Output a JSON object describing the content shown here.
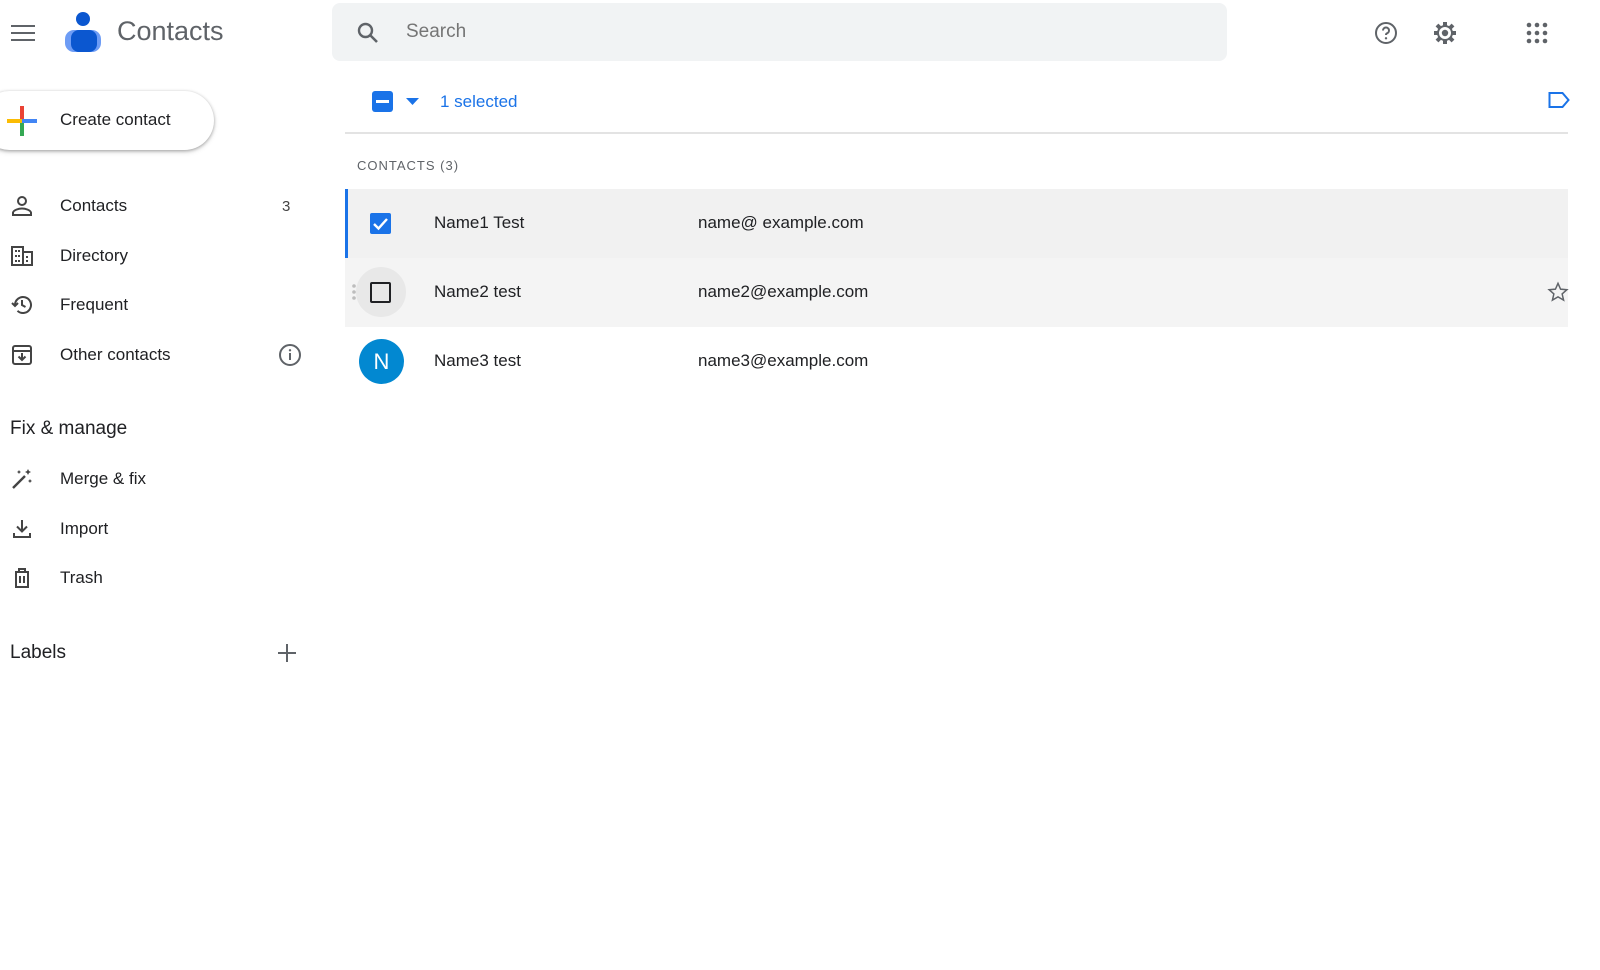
{
  "app": {
    "title": "Contacts"
  },
  "search": {
    "placeholder": "Search"
  },
  "create_contact": "Create contact",
  "sidebar": {
    "items": [
      {
        "label": "Contacts",
        "count": "3"
      },
      {
        "label": "Directory"
      },
      {
        "label": "Frequent"
      },
      {
        "label": "Other contacts"
      }
    ],
    "fix_manage_heading": "Fix & manage",
    "fix_items": [
      {
        "label": "Merge & fix"
      },
      {
        "label": "Import"
      },
      {
        "label": "Trash"
      }
    ],
    "labels_heading": "Labels"
  },
  "toolbar": {
    "selected_text": "1 selected"
  },
  "list": {
    "header": "CONTACTS (3)",
    "contacts": [
      {
        "name": "Name1 Test",
        "email": "name@ example.com",
        "checked": true
      },
      {
        "name": "Name2 test",
        "email": "name2@example.com",
        "checked": false
      },
      {
        "name": "Name3 test",
        "email": "name3@example.com",
        "avatar": "N"
      }
    ]
  },
  "colors": {
    "accent": "#1a73e8",
    "avatar": "#0288d1"
  }
}
